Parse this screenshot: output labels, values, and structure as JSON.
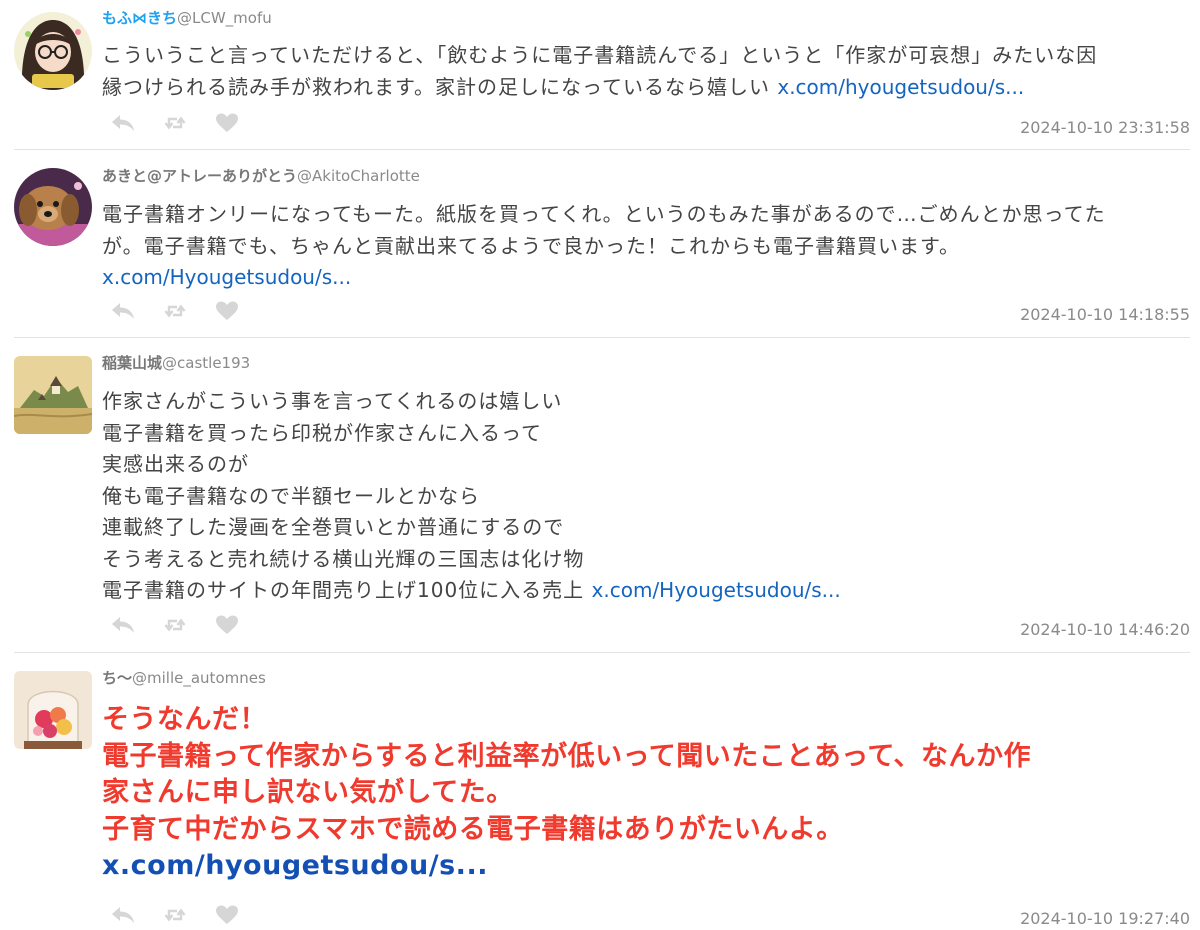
{
  "icons": {
    "reply": "reply-icon",
    "retweet": "retweet-icon",
    "like": "heart-icon"
  },
  "colors": {
    "accent_name": "#1da1f2",
    "link": "#1565c0",
    "highlight_text": "#f03a2e",
    "action_icons": "#d6d6d6"
  },
  "tweets": [
    {
      "name": "もふ⋈きち",
      "handle": "@LCW_mofu",
      "lines": [
        "こういうこと言っていただけると、「飲むように電子書籍読んでる」というと「作家が可哀想」みたいな因",
        "縁つけられる読み手が救われます。家計の足しになっているなら嬉しい "
      ],
      "link": "x.com/hyougetsudou/s...",
      "timestamp": "2024-10-10 23:31:58"
    },
    {
      "name": "あきと@アトレーありがとう",
      "handle": "@AkitoCharlotte",
      "lines": [
        "電子書籍オンリーになってもーた。紙版を買ってくれ。というのもみた事があるので…ごめんとか思ってた",
        "が。電子書籍でも、ちゃんと貢献出来てるようで良かった！これからも電子書籍買います。"
      ],
      "link": "x.com/Hyougetsudou/s...",
      "timestamp": "2024-10-10 14:18:55"
    },
    {
      "name": "稲葉山城",
      "handle": "@castle193",
      "lines": [
        "作家さんがこういう事を言ってくれるのは嬉しい",
        "電子書籍を買ったら印税が作家さんに入るって",
        "実感出来るのが",
        "俺も電子書籍なので半額セールとかなら",
        "連載終了した漫画を全巻買いとか普通にするので",
        "そう考えると売れ続ける横山光輝の三国志は化け物",
        "電子書籍のサイトの年間売り上げ100位に入る売上 "
      ],
      "link": "x.com/Hyougetsudou/s...",
      "timestamp": "2024-10-10 14:46:20"
    },
    {
      "name": "ち〜",
      "handle": "@mille_automnes",
      "lines": [
        "そうなんだ！",
        "電子書籍って作家からすると利益率が低いって聞いたことあって、なんか作",
        "家さんに申し訳ない気がしてた。",
        "子育て中だからスマホで読める電子書籍はありがたいんよ。"
      ],
      "link": "x.com/hyougetsudou/s...",
      "timestamp": "2024-10-10 19:27:40"
    }
  ]
}
